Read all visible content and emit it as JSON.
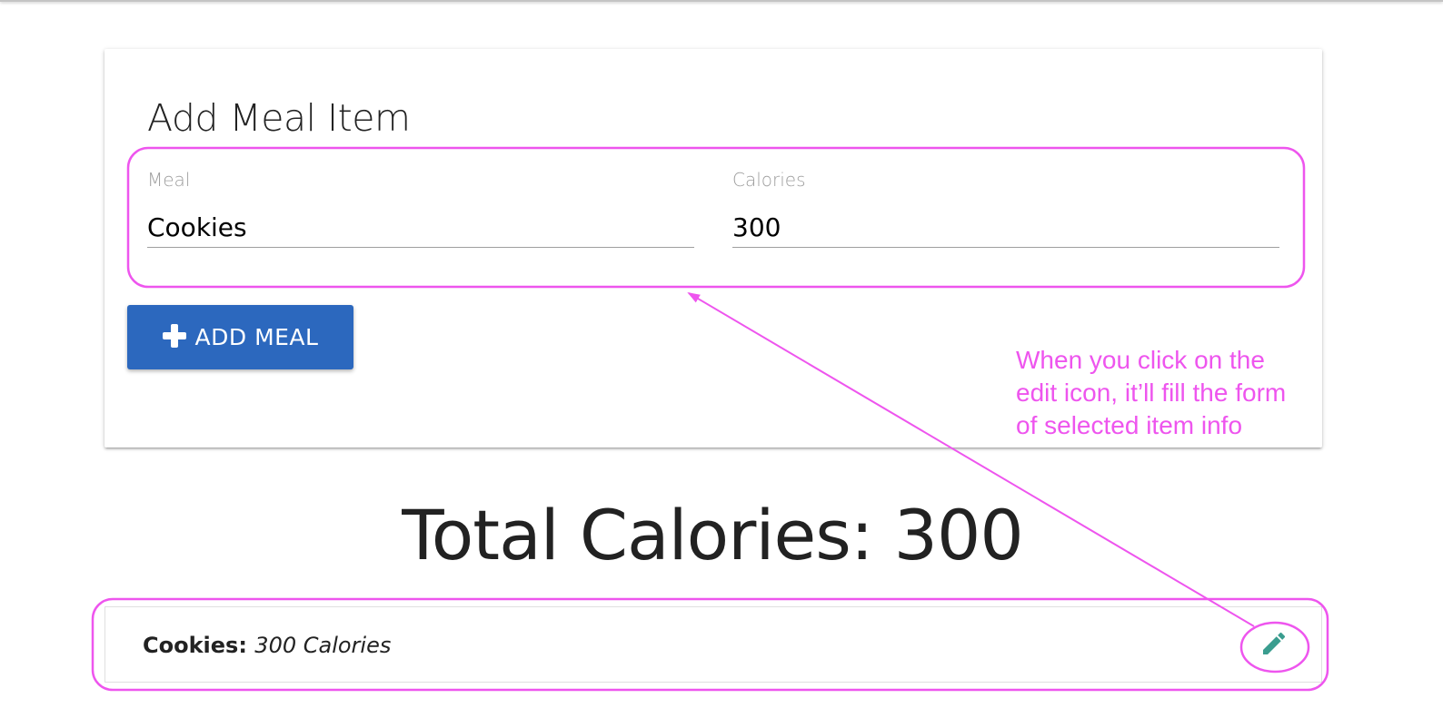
{
  "form": {
    "title": "Add Meal Item",
    "meal_label": "Meal",
    "meal_value": "Cookies",
    "calories_label": "Calories",
    "calories_value": "300",
    "add_button_label": "ADD MEAL",
    "add_button_icon": "plus-icon"
  },
  "summary": {
    "total_text": "Total Calories: 300"
  },
  "items": [
    {
      "name": "Cookies:",
      "calories": "300 Calories",
      "edit_icon": "pencil-icon"
    }
  ],
  "annotation": {
    "lines": [
      "When you click on the",
      "edit icon, it’ll fill the form",
      "of selected item info"
    ],
    "color": "#ee55ee"
  },
  "colors": {
    "button": "#2c68be",
    "edit_icon": "#3a9d8f",
    "annotation": "#ee55ee"
  }
}
